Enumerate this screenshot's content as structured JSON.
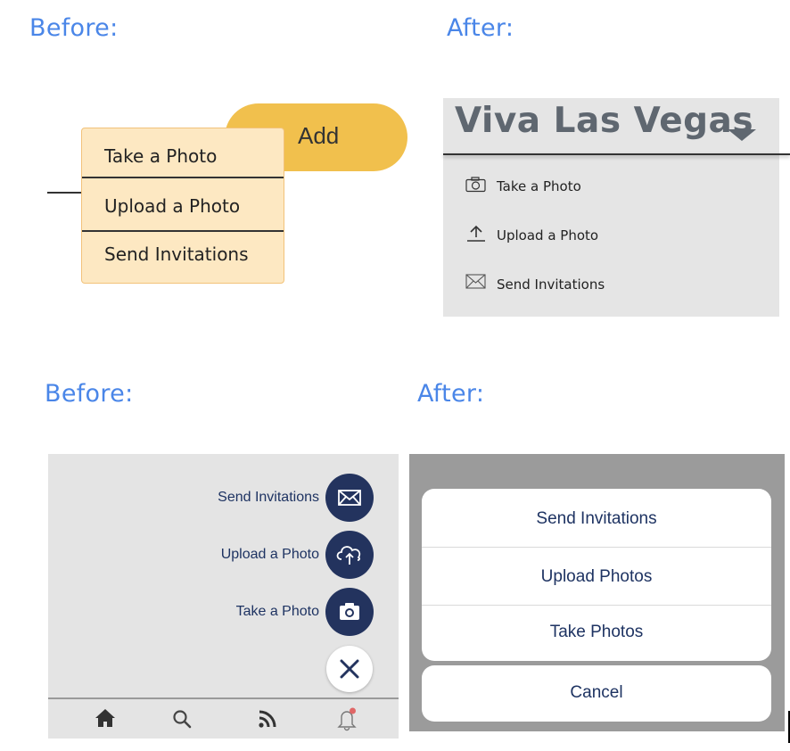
{
  "headings": {
    "top_before": "Before:",
    "top_after": "After:",
    "bottom_before": "Before:",
    "bottom_after": "After:"
  },
  "top_before": {
    "add_label": "Add",
    "items": [
      "Take a Photo",
      "Upload a Photo",
      "Send Invitations"
    ],
    "colors": {
      "add": "#f1c04d",
      "menu_bg": "#fde8c2",
      "menu_border": "#f2c27a"
    }
  },
  "top_after": {
    "title": "Viva Las Vegas",
    "items": [
      {
        "label": "Take a Photo",
        "icon": "camera-icon"
      },
      {
        "label": "Upload a Photo",
        "icon": "upload-icon"
      },
      {
        "label": "Send Invitations",
        "icon": "envelope-icon"
      }
    ]
  },
  "bottom_before": {
    "items": [
      {
        "label": "Send Invitations",
        "icon": "envelope-icon"
      },
      {
        "label": "Upload a Photo",
        "icon": "cloud-upload-icon"
      },
      {
        "label": "Take a Photo",
        "icon": "camera-icon"
      }
    ],
    "close_icon": "close-icon",
    "tabbar": [
      "home-icon",
      "search-icon",
      "rss-feed-icon",
      "notification-bell-icon"
    ],
    "colors": {
      "fab": "#23335e",
      "notification_dot": "#e06666"
    }
  },
  "bottom_after": {
    "options": [
      "Send Invitations",
      "Upload Photos",
      "Take Photos"
    ],
    "cancel": "Cancel",
    "colors": {
      "text": "#1e3362"
    }
  }
}
